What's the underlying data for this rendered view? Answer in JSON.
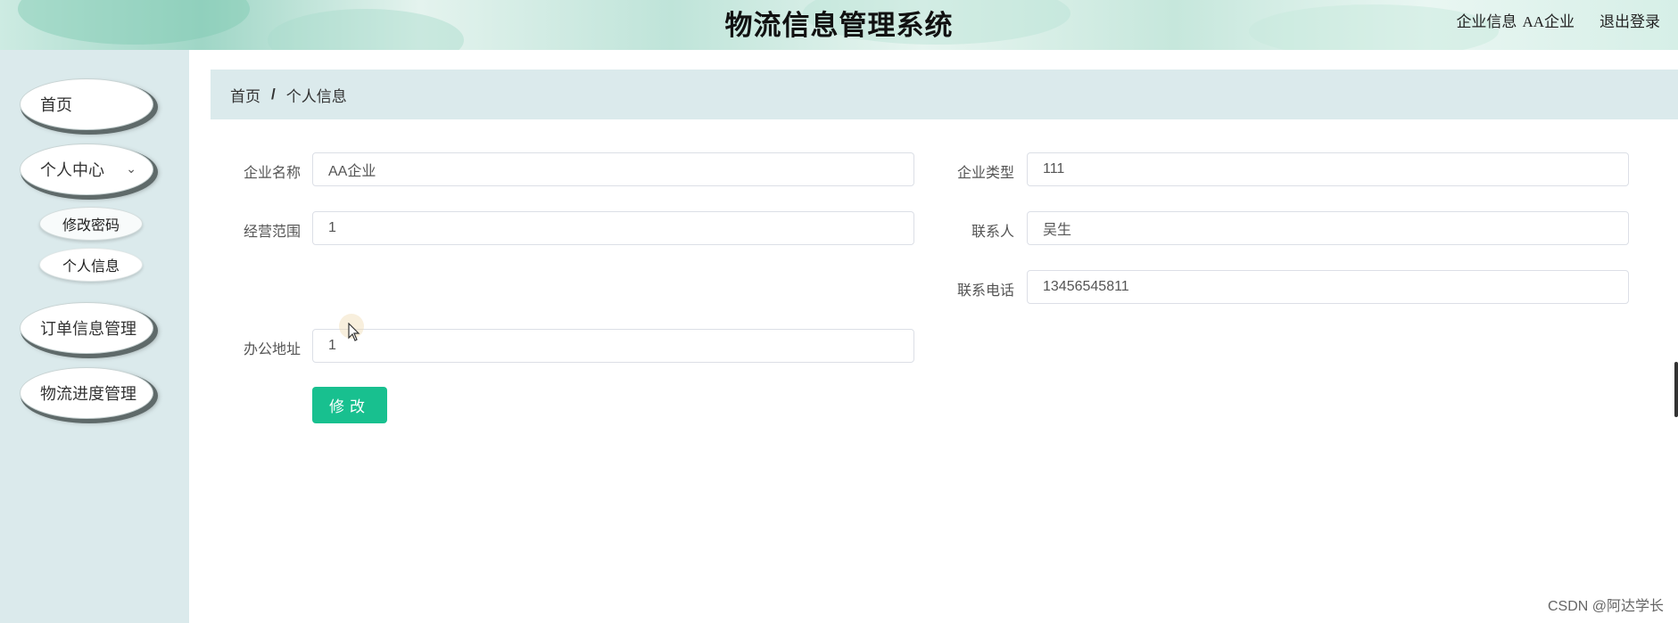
{
  "header": {
    "title": "物流信息管理系统",
    "user_label": "企业信息",
    "user_name": "AA企业",
    "logout_label": "退出登录"
  },
  "sidebar": {
    "items": [
      {
        "label": "首页"
      },
      {
        "label": "个人中心",
        "expanded": true,
        "children": [
          {
            "label": "修改密码"
          },
          {
            "label": "个人信息",
            "active": true
          }
        ]
      },
      {
        "label": "订单信息管理"
      },
      {
        "label": "物流进度管理"
      }
    ]
  },
  "breadcrumb": {
    "home": "首页",
    "separator": "/",
    "current": "个人信息"
  },
  "form": {
    "company_name": {
      "label": "企业名称",
      "value": "AA企业"
    },
    "company_type": {
      "label": "企业类型",
      "value": "111"
    },
    "business_scope": {
      "label": "经营范围",
      "value": "1"
    },
    "contact_person": {
      "label": "联系人",
      "value": "吴生"
    },
    "contact_phone": {
      "label": "联系电话",
      "value": "13456545811"
    },
    "office_address": {
      "label": "办公地址",
      "value": "1"
    },
    "submit_label": "修改"
  },
  "watermark": "CSDN @阿达学长",
  "colors": {
    "accent": "#18c08f",
    "sidebar_bg": "#dbeaec",
    "breadcrumb_bg": "#dbeaec"
  }
}
